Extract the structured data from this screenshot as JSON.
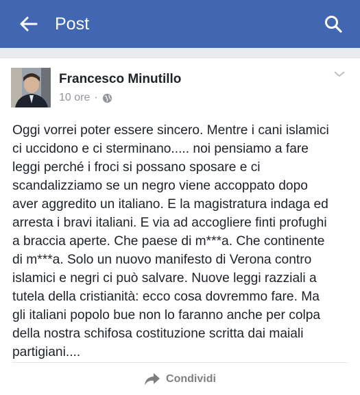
{
  "header": {
    "title": "Post",
    "back_icon": "arrow-left-icon",
    "search_icon": "search-icon",
    "background": "#4267b2"
  },
  "post": {
    "author": "Francesco Minutillo",
    "time": "10 ore",
    "separator": "·",
    "privacy_icon": "globe-icon",
    "lines": [
      "Oggi vorrei poter essere sincero. Mentre i cani islamici",
      "ci uccidono e ci sterminano..... noi pensiamo a fare",
      "leggi perché i froci si possano sposare e ci",
      "scandalizziamo se un negro viene accoppato dopo",
      "aver aggredito un italiano. E la magistratura indaga ed",
      "arresta i bravi italiani. E via ad accogliere finti profughi",
      "a braccia aperte. Che paese di m***a. Che continente",
      "di m***a. Solo un nuovo manifesto di Verona contro",
      "islamici e negri ci può salvare. Nuove leggi razziali a",
      "tutela della cristianità: ecco cosa dovremmo fare. Ma",
      "gli italiani popolo bue non lo faranno anche per colpa",
      "della nostra schifosa costituzione scritta dai maiali",
      "partigiani...."
    ],
    "share_label": "Condividi"
  }
}
